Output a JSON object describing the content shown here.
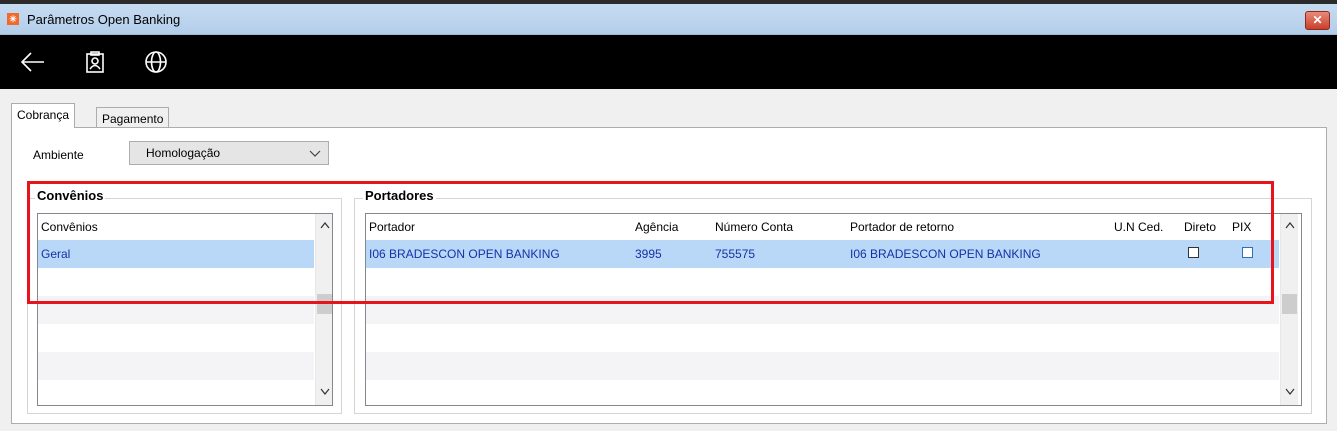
{
  "window": {
    "title": "Parâmetros Open Banking",
    "close_glyph": "✕"
  },
  "toolbar": {
    "icons": [
      "back-arrow-icon",
      "contact-card-icon",
      "globe-icon"
    ]
  },
  "tabs": [
    {
      "label": "Cobrança",
      "active": true
    },
    {
      "label": "Pagamento",
      "active": false
    }
  ],
  "ambiente": {
    "label": "Ambiente",
    "selected": "Homologação"
  },
  "convenios": {
    "group_title": "Convênios",
    "column": "Convênios",
    "rows": [
      "Geral"
    ]
  },
  "portadores": {
    "group_title": "Portadores",
    "columns": {
      "portador": "Portador",
      "agencia": "Agência",
      "numero_conta": "Número Conta",
      "portador_retorno": "Portador de retorno",
      "un_ced": "U.N Ced.",
      "direto": "Direto",
      "pix": "PIX"
    },
    "rows": [
      {
        "portador": "I06  BRADESCON OPEN BANKING",
        "agencia": "3995",
        "numero_conta": "755575",
        "portador_retorno": "I06  BRADESCON OPEN BANKING",
        "un_ced": "",
        "direto": false,
        "pix": false
      }
    ]
  },
  "colors": {
    "highlight_border": "#e8141b",
    "selected_row": "#b9d7f7",
    "row_text": "#1432a6"
  }
}
